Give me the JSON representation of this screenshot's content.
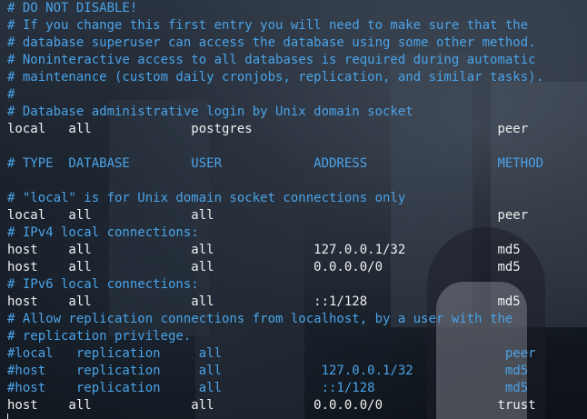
{
  "editor": {
    "colors": {
      "comment": "#4aa3e8",
      "text": "#f0f0f0"
    },
    "lines": [
      {
        "type": "comment",
        "text": "# DO NOT DISABLE!"
      },
      {
        "type": "comment",
        "text": "# If you change this first entry you will need to make sure that the"
      },
      {
        "type": "comment",
        "text": "# database superuser can access the database using some other method."
      },
      {
        "type": "comment",
        "text": "# Noninteractive access to all databases is required during automatic"
      },
      {
        "type": "comment",
        "text": "# maintenance (custom daily cronjobs, replication, and similar tasks)."
      },
      {
        "type": "comment",
        "text": "#"
      },
      {
        "type": "comment",
        "text": "# Database administrative login by Unix domain socket"
      },
      {
        "type": "text",
        "text": "local   all             postgres                                peer"
      },
      {
        "type": "text",
        "text": ""
      },
      {
        "type": "comment",
        "text": "# TYPE  DATABASE        USER            ADDRESS                 METHOD"
      },
      {
        "type": "text",
        "text": ""
      },
      {
        "type": "comment",
        "text": "# \"local\" is for Unix domain socket connections only"
      },
      {
        "type": "text",
        "text": "local   all             all                                     peer"
      },
      {
        "type": "comment",
        "text": "# IPv4 local connections:"
      },
      {
        "type": "text",
        "text": "host    all             all             127.0.0.1/32            md5"
      },
      {
        "type": "text",
        "text": "host    all             all             0.0.0.0/0               md5"
      },
      {
        "type": "comment",
        "text": "# IPv6 local connections:"
      },
      {
        "type": "text",
        "text": "host    all             all             ::1/128                 md5"
      },
      {
        "type": "comment",
        "text": "# Allow replication connections from localhost, by a user with the"
      },
      {
        "type": "comment",
        "text": "# replication privilege."
      },
      {
        "type": "comment",
        "text": "#local   replication     all                                     peer"
      },
      {
        "type": "comment",
        "text": "#host    replication     all             127.0.0.1/32            md5"
      },
      {
        "type": "comment",
        "text": "#host    replication     all             ::1/128                 md5"
      },
      {
        "type": "text",
        "text": "host    all             all             0.0.0.0/0               trust"
      }
    ]
  }
}
